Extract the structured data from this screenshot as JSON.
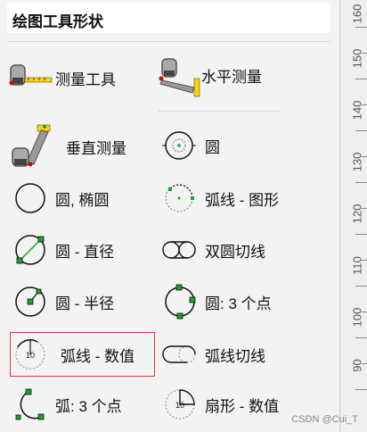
{
  "panel": {
    "title": "绘图工具形状"
  },
  "tools": {
    "measure": "测量工具",
    "horizontal": "水平测量",
    "vertical": "垂直测量",
    "circle": "圆",
    "circle_ellipse": "圆, 椭圆",
    "arc_graphic": "弧线 - 图形",
    "circle_diameter": "圆 - 直径",
    "double_tangent": "双圆切线",
    "circle_radius": "圆 - 半径",
    "circle_3pts": "圆: 3 个点",
    "arc_value": "弧线 - 数值",
    "arc_tangent": "弧线切线",
    "arc_3pts": "弧: 3 个点",
    "sector_value": "扇形 - 数值"
  },
  "icon_text": {
    "value": "10"
  },
  "ruler": {
    "labels": [
      "160",
      "150",
      "140",
      "130",
      "120",
      "110",
      "100",
      "90"
    ]
  },
  "watermark": "CSDN @Cui_T",
  "colors": {
    "green": "#19a51f",
    "selected_border": "#d9393a"
  }
}
